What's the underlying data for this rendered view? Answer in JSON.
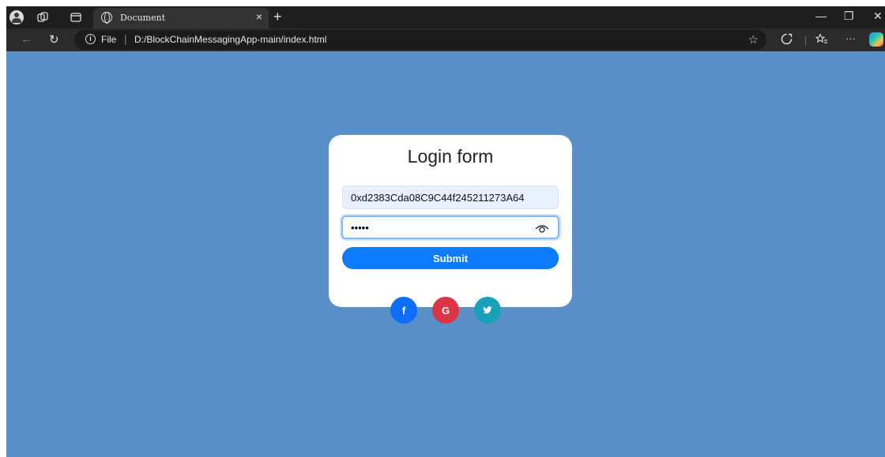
{
  "browser": {
    "tab": {
      "title": "Document",
      "close_glyph": "×"
    },
    "new_tab_glyph": "+",
    "window_controls": {
      "minimize": "—",
      "restore": "❐",
      "close": "✕"
    },
    "toolbar": {
      "back_glyph": "←",
      "refresh_glyph": "↻",
      "info_glyph": "i",
      "scheme_label": "File",
      "separator": "|",
      "url": "D:/BlockChainMessagingApp-main/index.html",
      "favorite_glyph": "☆",
      "more_glyph": "···"
    },
    "icons": [
      "profile-icon",
      "workspaces-icon",
      "tab-actions-icon",
      "globe-icon",
      "star-icon",
      "extensions-icon",
      "favorites-icon",
      "copilot-icon"
    ]
  },
  "login": {
    "title": "Login form",
    "address_value": "0xd2383Cda08C9C44f245211273A64",
    "password_value": "•••••",
    "submit_label": "Submit"
  },
  "social": {
    "facebook_label": "f",
    "google_label": "G",
    "twitter_label": "🐦"
  },
  "colors": {
    "page_background": "#5b8fc8",
    "submit": "#0d7bff",
    "facebook": "#0d6efd",
    "google": "#dc3545",
    "twitter": "#17a2b8"
  }
}
